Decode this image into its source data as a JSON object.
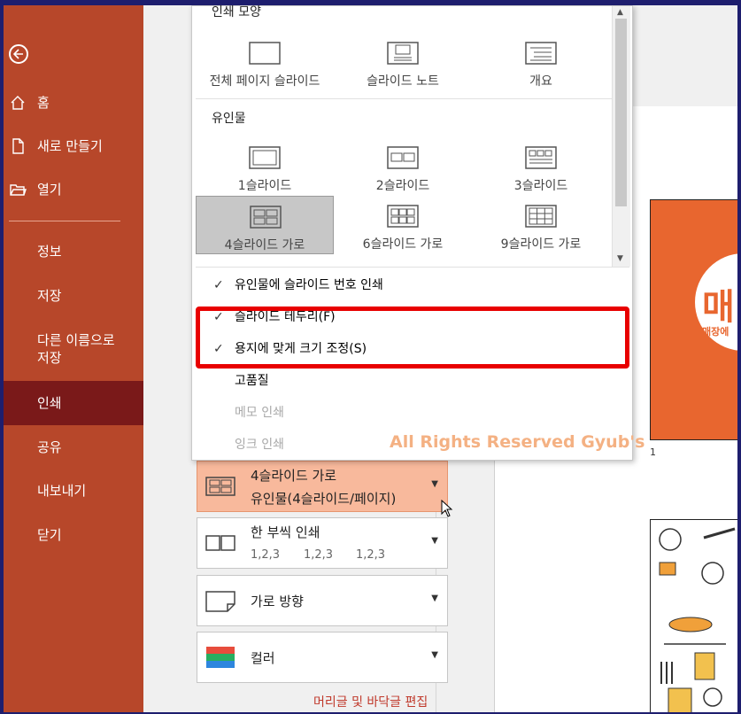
{
  "sidebar": {
    "home": "홈",
    "new": "새로 만들기",
    "open": "열기",
    "info": "정보",
    "save": "저장",
    "save_as_1": "다른 이름으로",
    "save_as_2": "저장",
    "print": "인쇄",
    "share": "공유",
    "export": "내보내기",
    "close": "닫기"
  },
  "dropdown": {
    "print_layout_header": "인쇄 모양",
    "print_layouts": [
      "전체 페이지 슬라이드",
      "슬라이드 노트",
      "개요"
    ],
    "handouts_header": "유인물",
    "handouts_row1": [
      "1슬라이드",
      "2슬라이드",
      "3슬라이드"
    ],
    "handouts_row2": [
      "4슬라이드 가로",
      "6슬라이드 가로",
      "9슬라이드 가로"
    ],
    "options": {
      "slide_numbers": "유인물에 슬라이드 번호 인쇄",
      "frame_slides": "슬라이드 테두리(F)",
      "scale_to_fit": "용지에 맞게 크기 조정(S)",
      "high_quality": "고품질",
      "print_comments": "메모 인쇄",
      "print_ink": "잉크 인쇄"
    }
  },
  "watermark": "All Rights Reserved Gyub's",
  "settings": {
    "layout_line1": "4슬라이드 가로",
    "layout_line2": "유인물(4슬라이드/페이지)",
    "collate_label": "한 부씩 인쇄",
    "collate_seq": [
      "1,2,3",
      "1,2,3",
      "1,2,3"
    ],
    "orientation": "가로 방향",
    "color": "컬러"
  },
  "footer_link": "머리글 및 바닥글 편집",
  "preview": {
    "page_number": "1",
    "slide_big": "매",
    "slide_small": "매장에"
  },
  "colors": {
    "sidebar": "#b7472a",
    "active_nav": "#7a1919",
    "highlight": "#f8b99c",
    "red_box": "#e80000"
  }
}
